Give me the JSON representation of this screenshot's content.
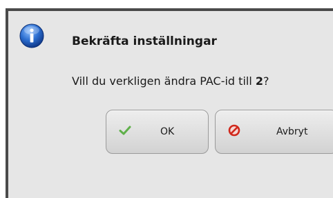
{
  "dialog": {
    "title": "Bekräfta inställningar",
    "message_prefix": "Vill du verkligen ändra PAC-id till ",
    "message_value": "2",
    "message_suffix": "?",
    "icon": "info-icon"
  },
  "buttons": {
    "ok": {
      "label": "OK",
      "icon": "checkmark-icon",
      "icon_color": "#5fb04a"
    },
    "cancel": {
      "label": "Avbryt",
      "icon": "prohibit-icon",
      "icon_color": "#d0281c"
    }
  },
  "colors": {
    "dialog_background": "#e6e6e6",
    "border": "#4a4a4a",
    "info_blue": "#1f5fb8"
  }
}
